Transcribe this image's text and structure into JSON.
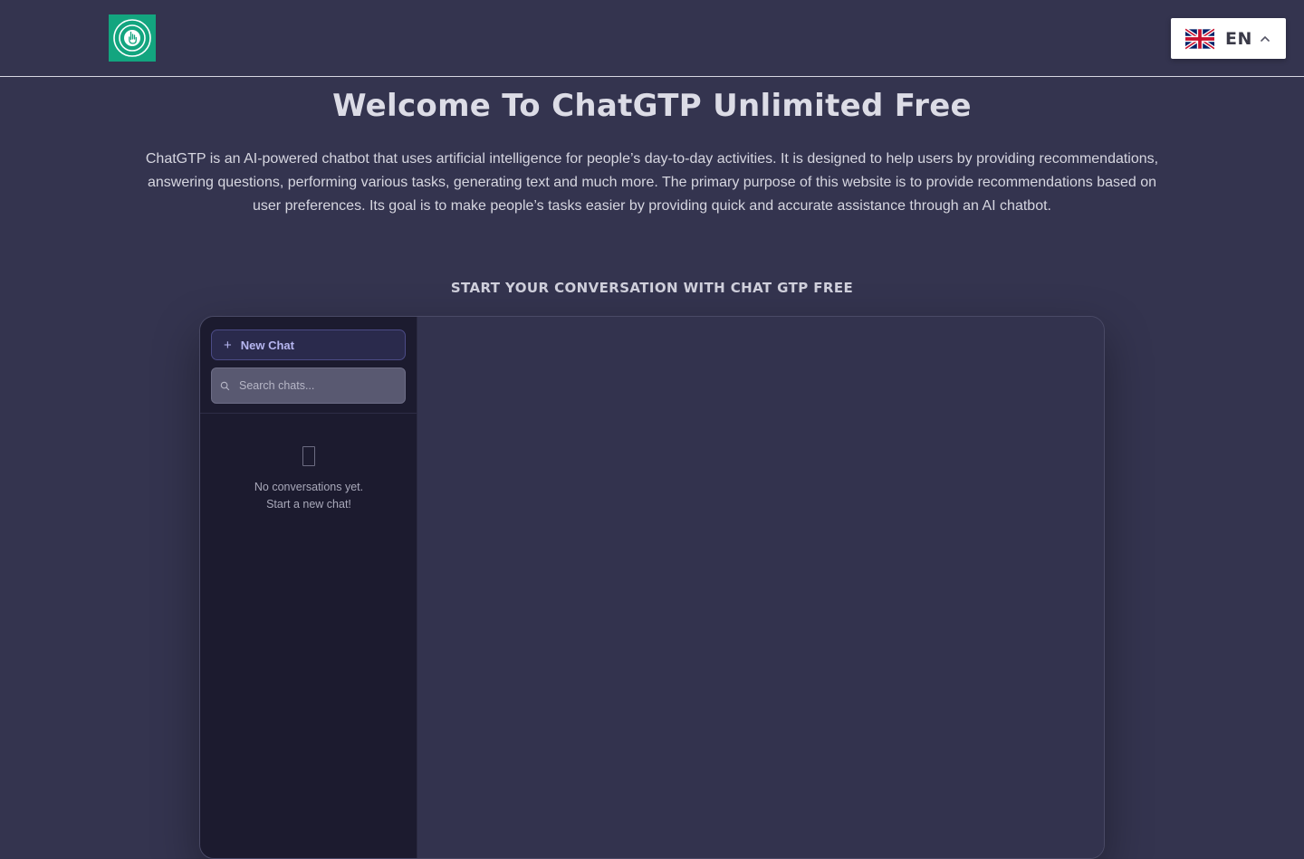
{
  "header": {
    "logo_icon": "pointer-hand-icon",
    "language": {
      "code": "EN",
      "flag_icon": "uk-flag-icon",
      "chevron_icon": "chevron-up-icon"
    }
  },
  "hero": {
    "title": "Welcome To ChatGTP Unlimited Free",
    "intro": "ChatGTP is an AI-powered chatbot that uses artificial intelligence for people’s day-to-day activities. It is designed to help users by providing recommendations, answering questions, performing various tasks, generating text and much more. The primary purpose of this website is to provide recommendations based on user preferences. Its goal is to make people’s tasks easier by providing quick and accurate assistance through an AI chatbot.",
    "subtitle": "START YOUR CONVERSATION WITH CHAT GTP FREE"
  },
  "chat": {
    "new_chat_label": "New Chat",
    "plus_glyph": "+",
    "search_placeholder": "Search chats...",
    "empty_line1": "No conversations yet.",
    "empty_line2": "Start a new chat!"
  },
  "colors": {
    "background": "#34344f",
    "logo": "#13a57f",
    "sidebar": "#1c1b2f",
    "accent": "#b6b6f0"
  }
}
